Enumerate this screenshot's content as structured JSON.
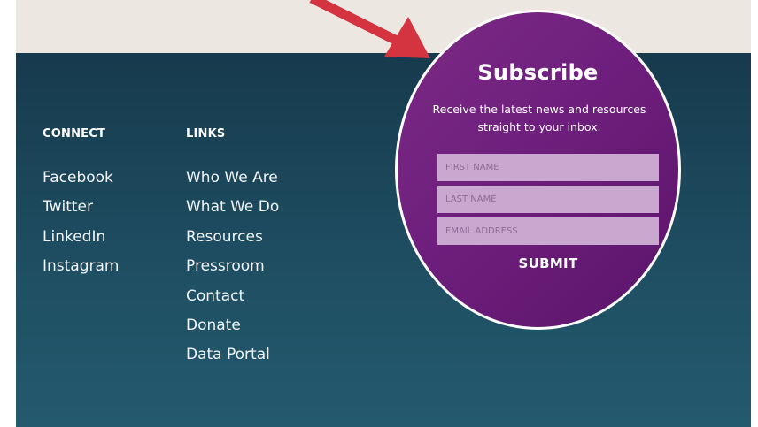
{
  "connect": {
    "heading": "CONNECT",
    "items": [
      "Facebook",
      "Twitter",
      "LinkedIn",
      "Instagram"
    ]
  },
  "links": {
    "heading": "LINKS",
    "items": [
      "Who We Are",
      "What We Do",
      "Resources",
      "Pressroom",
      "Contact",
      "Donate",
      "Data Portal"
    ]
  },
  "subscribe": {
    "title": "Subscribe",
    "description": "Receive the latest news and resources straight to your inbox.",
    "first_name_placeholder": "FIRST NAME",
    "last_name_placeholder": "LAST NAME",
    "email_placeholder": "EMAIL ADDRESS",
    "submit_label": "SUBMIT"
  },
  "colors": {
    "footer_bg": "#1f4f63",
    "top_band": "#ede7e1",
    "circle_purple": "#6e1f7d",
    "input_bg": "#c8a8cf",
    "arrow_red": "#d4343f"
  }
}
